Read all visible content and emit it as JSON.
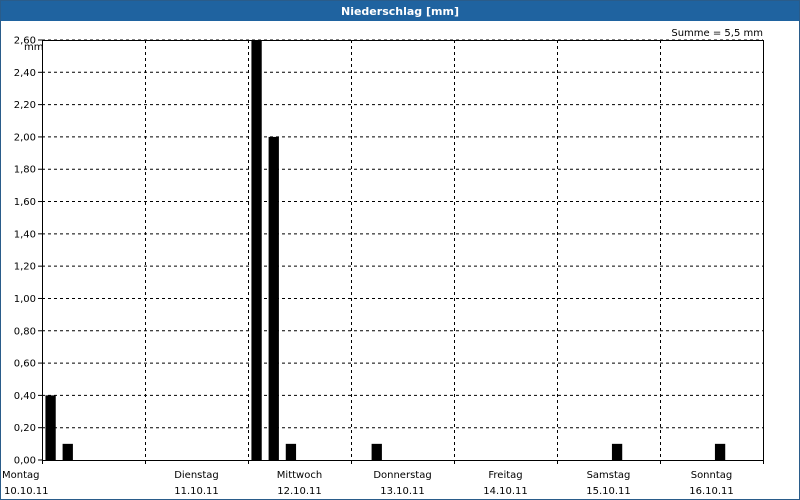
{
  "window": {
    "title": "Niederschlag [mm]"
  },
  "chart_data": {
    "type": "bar",
    "ylabel": "mm",
    "sum_label": "Summe = 5,5 mm",
    "ylim": [
      0,
      2.6
    ],
    "yticks": [
      0,
      0.2,
      0.4,
      0.6,
      0.8,
      1.0,
      1.2,
      1.4,
      1.6,
      1.8,
      2.0,
      2.2,
      2.4,
      2.6
    ],
    "ytick_labels": [
      "0,00",
      "0,20",
      "0,40",
      "0,60",
      "0,80",
      "1,00",
      "1,20",
      "1,40",
      "1,60",
      "1,80",
      "2,00",
      "2,20",
      "2,40",
      "2,60"
    ],
    "days": [
      {
        "name": "Montag",
        "date": "10.10.11"
      },
      {
        "name": "Dienstag",
        "date": "11.10.11"
      },
      {
        "name": "Mittwoch",
        "date": "12.10.11"
      },
      {
        "name": "Donnerstag",
        "date": "13.10.11"
      },
      {
        "name": "Freitag",
        "date": "14.10.11"
      },
      {
        "name": "Samstag",
        "date": "15.10.11"
      },
      {
        "name": "Sonntag",
        "date": "16.10.11"
      }
    ],
    "bars_per_day": 6,
    "values": [
      0.4,
      0.1,
      0,
      0,
      0,
      0,
      0,
      0,
      0,
      0,
      0,
      0,
      2.6,
      2.0,
      0.1,
      0,
      0,
      0,
      0,
      0.1,
      0,
      0,
      0,
      0,
      0,
      0,
      0,
      0,
      0,
      0,
      0,
      0,
      0,
      0.1,
      0,
      0,
      0,
      0,
      0,
      0.1,
      0,
      0
    ],
    "bar_color": "#000000",
    "grid": true
  }
}
